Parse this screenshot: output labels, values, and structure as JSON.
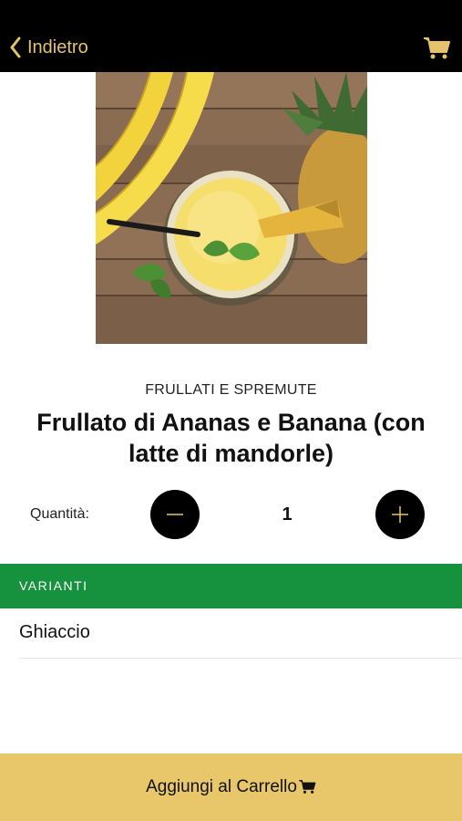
{
  "navbar": {
    "back_label": "Indietro",
    "back_icon": "chevron-left-icon",
    "cart_icon": "cart-icon",
    "accent_color": "#e5c36b"
  },
  "product": {
    "category": "FRULLATI E SPREMUTE",
    "title": "Frullato di Ananas e Banana (con latte di mandorle)",
    "image_subject": "pineapple banana smoothie"
  },
  "quantity": {
    "label": "Quantità:",
    "value": "1",
    "decrement_icon": "minus-icon",
    "increment_icon": "plus-icon"
  },
  "variants": {
    "section_title": "VARIANTI",
    "section_color": "#16913d",
    "items": [
      {
        "label": "Ghiaccio"
      }
    ]
  },
  "footer": {
    "add_to_cart_label": "Aggiungi al Carrello",
    "cart_icon": "cart-icon",
    "button_color": "#e8c76b"
  }
}
